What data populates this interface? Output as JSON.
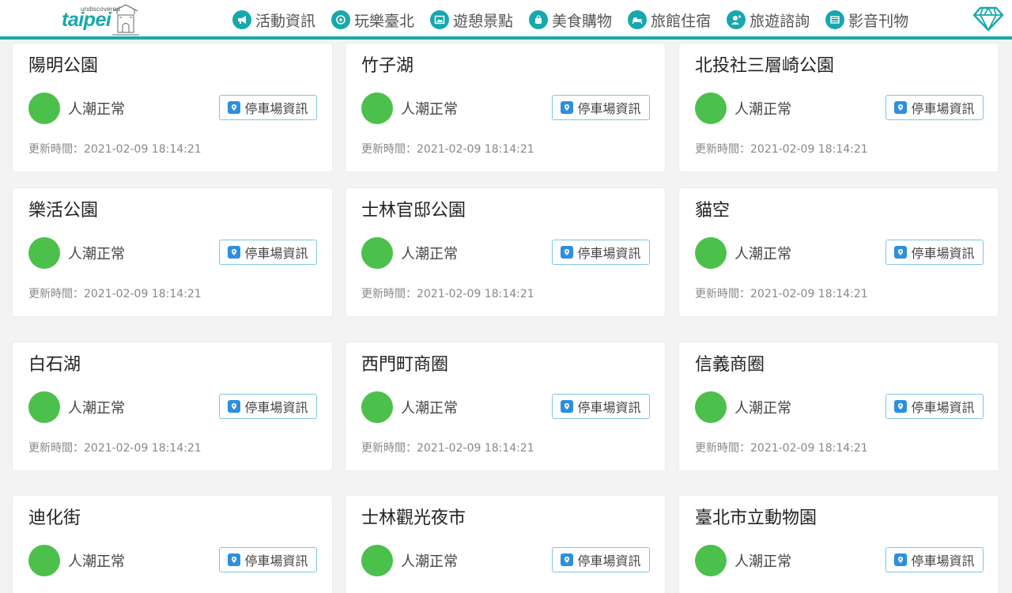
{
  "header": {
    "logo": {
      "small": "undiscovered",
      "big": "taipei"
    },
    "nav": [
      {
        "label": "活動資訊",
        "icon": "megaphone-icon"
      },
      {
        "label": "玩樂臺北",
        "icon": "play-icon"
      },
      {
        "label": "遊憩景點",
        "icon": "picture-icon"
      },
      {
        "label": "美食購物",
        "icon": "shopping-bag-icon"
      },
      {
        "label": "旅館住宿",
        "icon": "bed-icon"
      },
      {
        "label": "旅遊諮詢",
        "icon": "consult-icon"
      },
      {
        "label": "影音刊物",
        "icon": "film-icon"
      }
    ],
    "diamond_icon": "diamond-icon"
  },
  "colors": {
    "accent": "#17a8ad",
    "status_normal": "#4bc04b",
    "parking_pin": "#2d8fe0"
  },
  "cards": [
    {
      "title": "陽明公園",
      "status": "人潮正常",
      "parking": "停車場資訊",
      "updated": "更新時間：2021-02-09 18:14:21"
    },
    {
      "title": "竹子湖",
      "status": "人潮正常",
      "parking": "停車場資訊",
      "updated": "更新時間：2021-02-09 18:14:21"
    },
    {
      "title": "北投社三層崎公園",
      "status": "人潮正常",
      "parking": "停車場資訊",
      "updated": "更新時間：2021-02-09 18:14:21"
    },
    {
      "title": "樂活公園",
      "status": "人潮正常",
      "parking": "停車場資訊",
      "updated": "更新時間：2021-02-09 18:14:21"
    },
    {
      "title": "士林官邸公園",
      "status": "人潮正常",
      "parking": "停車場資訊",
      "updated": "更新時間：2021-02-09 18:14:21"
    },
    {
      "title": "貓空",
      "status": "人潮正常",
      "parking": "停車場資訊",
      "updated": "更新時間：2021-02-09 18:14:21"
    },
    {
      "title": "白石湖",
      "status": "人潮正常",
      "parking": "停車場資訊",
      "updated": "更新時間：2021-02-09 18:14:21"
    },
    {
      "title": "西門町商圈",
      "status": "人潮正常",
      "parking": "停車場資訊",
      "updated": "更新時間：2021-02-09 18:14:21"
    },
    {
      "title": "信義商圈",
      "status": "人潮正常",
      "parking": "停車場資訊",
      "updated": "更新時間：2021-02-09 18:14:21"
    },
    {
      "title": "迪化街",
      "status": "人潮正常",
      "parking": "停車場資訊",
      "updated": ""
    },
    {
      "title": "士林觀光夜市",
      "status": "人潮正常",
      "parking": "停車場資訊",
      "updated": ""
    },
    {
      "title": "臺北市立動物園",
      "status": "人潮正常",
      "parking": "停車場資訊",
      "updated": ""
    }
  ]
}
